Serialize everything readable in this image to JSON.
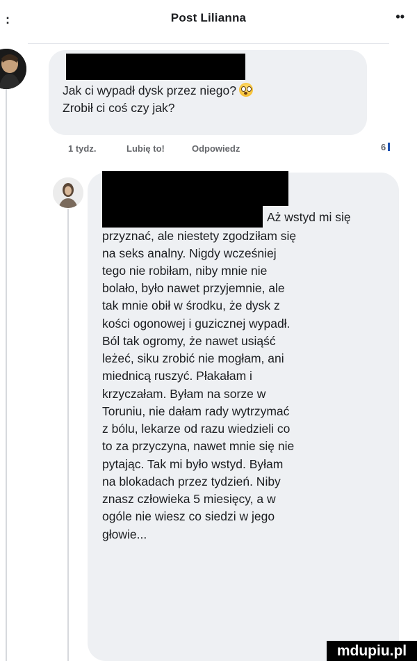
{
  "header": {
    "title": "Post Lilianna",
    "back_mark": ":",
    "more_mark": "••"
  },
  "comment1": {
    "line1": "Jak ci wypadł dysk przez niego?",
    "emoji": "astonished-face-emoji",
    "line2": "Zrobił ci coś czy jak?",
    "actions": {
      "time": "1 tydz.",
      "like": "Lubię to!",
      "reply": "Odpowiedz"
    },
    "reply_count": "6"
  },
  "comment2": {
    "lines": [
      "Aż wstyd mi się",
      "przyznać, ale niestety zgodziłam się",
      "na seks analny. Nigdy wcześniej",
      "tego nie robiłam, niby mnie nie",
      "bolało, było nawet przyjemnie, ale",
      "tak mnie obił w środku, że dysk z",
      "kości ogonowej i guzicznej wypadł.",
      "Ból tak ogromy, że nawet usiąść",
      "leżeć, siku zrobić nie mogłam, ani",
      "miednicą ruszyć. Płakałam i",
      "krzyczałam. Byłam na sorze w",
      "Toruniu, nie dałam rady wytrzymać",
      "z bólu, lekarze od razu wiedzieli co",
      "to za przyczyna, nawet mnie się nie",
      "pytając. Tak mi było wstyd. Byłam",
      "na blokadach przez tydzień. Niby",
      "znasz człowieka 5 miesięcy, a w",
      "ogóle nie wiesz co siedzi w jego",
      "głowie..."
    ]
  },
  "watermark": "mdupiu.pl",
  "colors": {
    "bubble": "#eef0f3",
    "meta_text": "#65676b",
    "reply_accent": "#1b4fb0"
  }
}
